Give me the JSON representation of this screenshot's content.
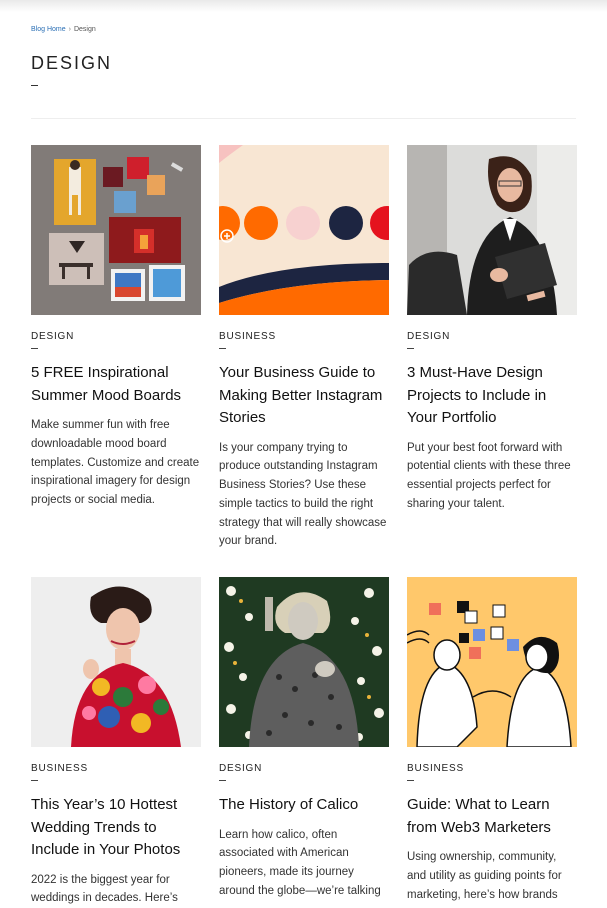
{
  "breadcrumb": {
    "home": "Blog Home",
    "separator": "›",
    "current": "Design"
  },
  "page": {
    "title": "DESIGN"
  },
  "colors": {
    "link": "#2a6fb5",
    "accent_orange": "#ff6a00",
    "navy": "#1d2541",
    "yellow": "#ffc86b"
  },
  "posts": [
    {
      "category": "DESIGN",
      "title": "5 FREE Inspirational Summer Mood Boards",
      "description": "Make summer fun with free downloadable mood board templates. Customize and create inspirational imagery for design projects or social media.",
      "image": "mood-board-collage-image"
    },
    {
      "category": "BUSINESS",
      "title": "Your Business Guide to Making Better Instagram Stories",
      "description": "Is your company trying to produce outstanding Instagram Business Stories? Use these simple tactics to build the right strategy that will really showcase your brand.",
      "image": "instagram-dots-graphic-image"
    },
    {
      "category": "DESIGN",
      "title": "3 Must-Have Design Projects to Include in Your Portfolio",
      "description": "Put your best foot forward with potential clients with these three essential projects perfect for sharing your talent.",
      "image": "woman-with-portfolio-image"
    },
    {
      "category": "BUSINESS",
      "title": "This Year’s 10 Hottest Wedding Trends to Include in Your Photos",
      "description": "2022 is the biggest year for weddings in decades. Here’s",
      "image": "floral-dress-woman-image"
    },
    {
      "category": "DESIGN",
      "title": "The History of Calico",
      "description": "Learn how calico, often associated with American pioneers, made its journey around the globe—we’re talking",
      "image": "calico-vintage-woman-image"
    },
    {
      "category": "BUSINESS",
      "title": "Guide: What to Learn from Web3 Marketers",
      "description": "Using ownership, community, and utility as guiding points for marketing, here’s how brands",
      "image": "web3-illustration-image"
    }
  ]
}
